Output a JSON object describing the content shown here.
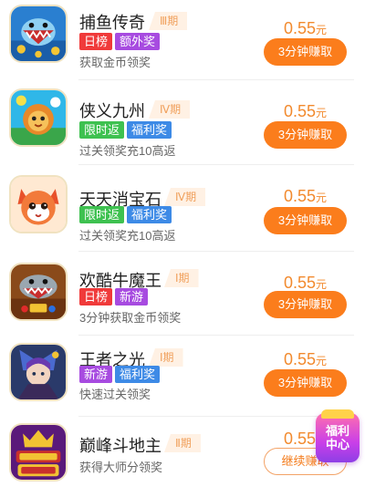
{
  "colors": {
    "accent": "#fb7d1c",
    "price": "#f28a2e",
    "tag_red": "#f03a3a",
    "tag_purple": "#a74be0",
    "tag_green": "#3ec150",
    "tag_blue": "#3d8ae6",
    "period_text": "#f0a05c",
    "period_bg": "#fff1e4"
  },
  "games": [
    {
      "title": "捕鱼传奇",
      "period": "Ⅲ期",
      "tags": [
        {
          "label": "日榜",
          "color": "#f03a3a"
        },
        {
          "label": "额外奖",
          "color": "#a74be0"
        }
      ],
      "desc": "获取金币领奖",
      "price": "0.55",
      "unit": "元",
      "button": "3分钟赚取",
      "icon": "fishing-game-icon"
    },
    {
      "title": "侠义九州",
      "period": "Ⅳ期",
      "tags": [
        {
          "label": "限时返",
          "color": "#3ec150"
        },
        {
          "label": "福利奖",
          "color": "#3d8ae6"
        }
      ],
      "desc": "过关领奖充10高返",
      "price": "0.55",
      "unit": "元",
      "button": "3分钟赚取",
      "icon": "lion-hero-game-icon"
    },
    {
      "title": "天天消宝石",
      "period": "Ⅳ期",
      "tags": [
        {
          "label": "限时返",
          "color": "#3ec150"
        },
        {
          "label": "福利奖",
          "color": "#3d8ae6"
        }
      ],
      "desc": "过关领奖充10高返",
      "price": "0.55",
      "unit": "元",
      "button": "3分钟赚取",
      "icon": "fox-gem-game-icon"
    },
    {
      "title": "欢酷牛魔王",
      "period": "Ⅰ期",
      "tags": [
        {
          "label": "日榜",
          "color": "#f03a3a"
        },
        {
          "label": "新游",
          "color": "#a74be0"
        }
      ],
      "desc": "3分钟获取金币领奖",
      "price": "0.55",
      "unit": "元",
      "button": "3分钟赚取",
      "icon": "shark-arcade-game-icon"
    },
    {
      "title": "王者之光",
      "period": "Ⅰ期",
      "tags": [
        {
          "label": "新游",
          "color": "#a74be0"
        },
        {
          "label": "福利奖",
          "color": "#3d8ae6"
        }
      ],
      "desc": "快速过关领奖",
      "price": "0.55",
      "unit": "元",
      "button": "3分钟赚取",
      "icon": "warrior-game-icon"
    },
    {
      "title": "巅峰斗地主",
      "period": "Ⅱ期",
      "tags": [],
      "desc": "获得大师分领奖",
      "price": "0.55",
      "unit": "元",
      "button": "继续赚取",
      "icon": "poker-game-icon"
    }
  ],
  "float_badge": {
    "line1": "福利",
    "line2": "中心",
    "icon": "gift-center-icon"
  }
}
